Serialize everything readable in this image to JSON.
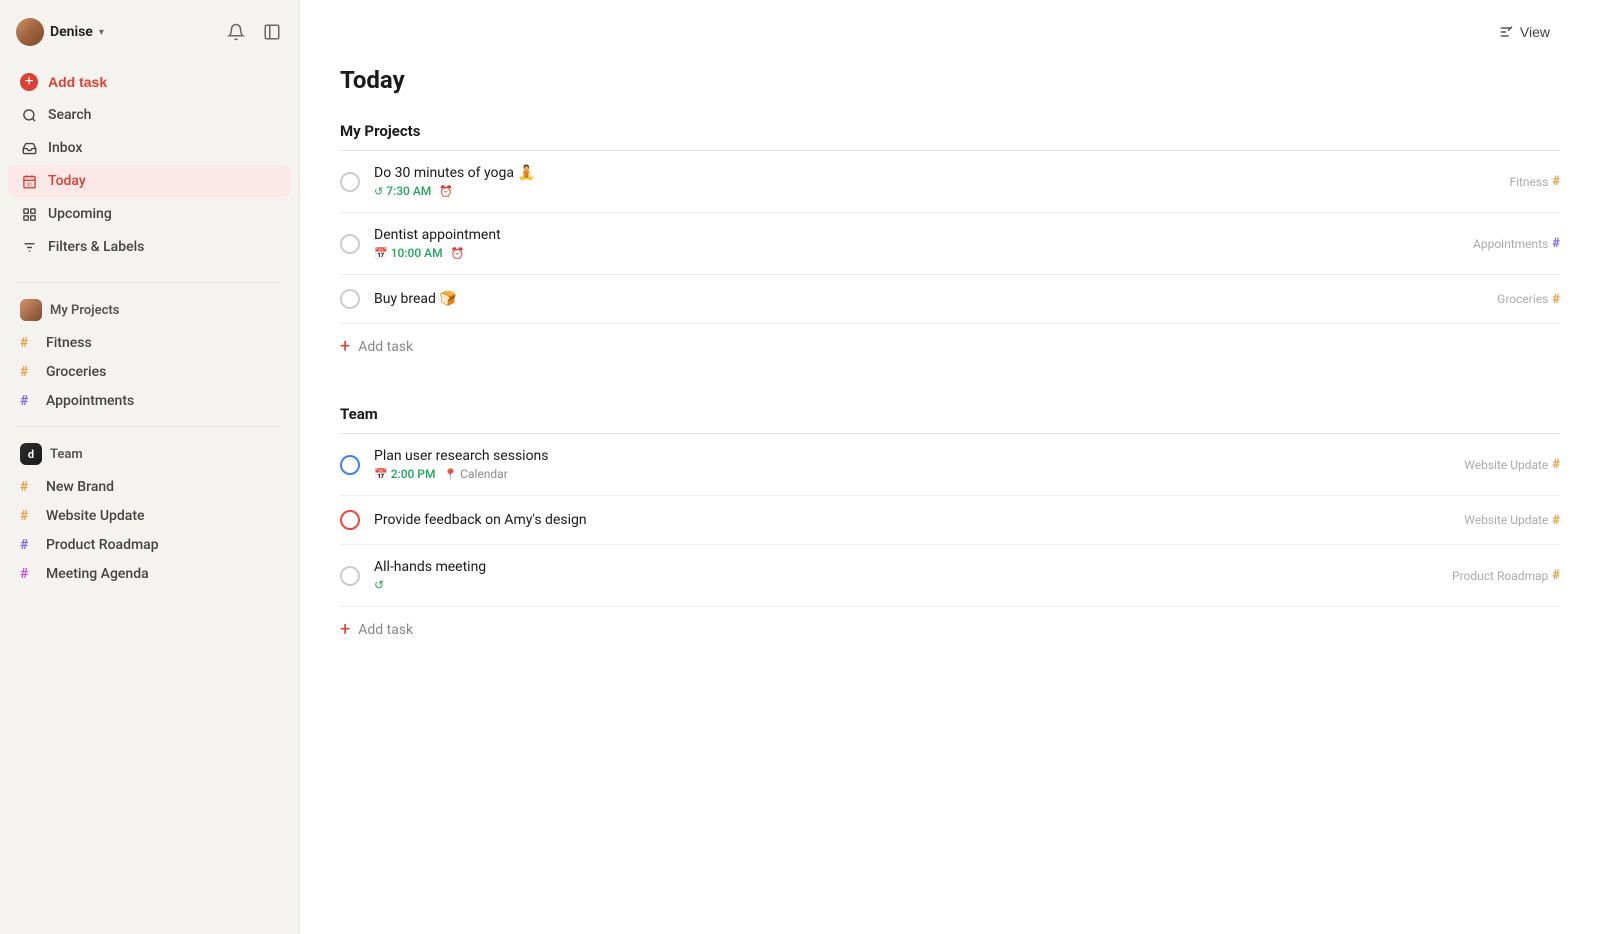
{
  "user": {
    "name": "Denise",
    "chevron": "▾"
  },
  "sidebar": {
    "add_task_label": "Add task",
    "nav_items": [
      {
        "id": "search",
        "label": "Search",
        "icon": "search"
      },
      {
        "id": "inbox",
        "label": "Inbox",
        "icon": "inbox"
      },
      {
        "id": "today",
        "label": "Today",
        "icon": "today",
        "active": true
      },
      {
        "id": "upcoming",
        "label": "Upcoming",
        "icon": "upcoming"
      },
      {
        "id": "filters",
        "label": "Filters & Labels",
        "icon": "filters"
      }
    ],
    "my_projects": {
      "label": "My Projects",
      "items": [
        {
          "id": "fitness",
          "label": "Fitness",
          "color": "#e8a04a"
        },
        {
          "id": "groceries",
          "label": "Groceries",
          "color": "#e8a04a"
        },
        {
          "id": "appointments",
          "label": "Appointments",
          "color": "#7c6af7"
        }
      ]
    },
    "team": {
      "label": "Team",
      "items": [
        {
          "id": "new-brand",
          "label": "New Brand",
          "color": "#e8a04a"
        },
        {
          "id": "website-update",
          "label": "Website Update",
          "color": "#e8a04a"
        },
        {
          "id": "product-roadmap",
          "label": "Product Roadmap",
          "color": "#7c6af7"
        },
        {
          "id": "meeting-agenda",
          "label": "Meeting Agenda",
          "color": "#d44fdb"
        }
      ]
    }
  },
  "main": {
    "title": "Today",
    "view_label": "View",
    "my_projects_section": {
      "label": "My Projects",
      "tasks": [
        {
          "id": "yoga",
          "name": "Do 30 minutes of yoga 🧘",
          "time": "7:30 AM",
          "has_alarm": true,
          "has_refresh": true,
          "project": "Fitness",
          "project_color": "#e8a04a",
          "checkbox_style": "default"
        },
        {
          "id": "dentist",
          "name": "Dentist appointment",
          "time": "10:00 AM",
          "has_alarm": true,
          "has_calendar": true,
          "project": "Appointments",
          "project_color": "#7c6af7",
          "checkbox_style": "default"
        },
        {
          "id": "bread",
          "name": "Buy bread 🍞",
          "time": null,
          "project": "Groceries",
          "project_color": "#e8a04a",
          "checkbox_style": "default"
        }
      ],
      "add_task_label": "Add task"
    },
    "team_section": {
      "label": "Team",
      "tasks": [
        {
          "id": "user-research",
          "name": "Plan user research sessions",
          "time": "2:00 PM",
          "has_calendar_icon": true,
          "calendar_label": "Calendar",
          "project": "Website Update",
          "project_color": "#e8a04a",
          "checkbox_style": "blue"
        },
        {
          "id": "feedback",
          "name": "Provide feedback on Amy's design",
          "time": null,
          "project": "Website Update",
          "project_color": "#e8a04a",
          "checkbox_style": "red"
        },
        {
          "id": "all-hands",
          "name": "All-hands meeting",
          "time": null,
          "has_refresh": true,
          "project": "Product Roadmap",
          "project_color": "#e8a04a",
          "checkbox_style": "default"
        }
      ],
      "add_task_label": "Add task"
    }
  }
}
